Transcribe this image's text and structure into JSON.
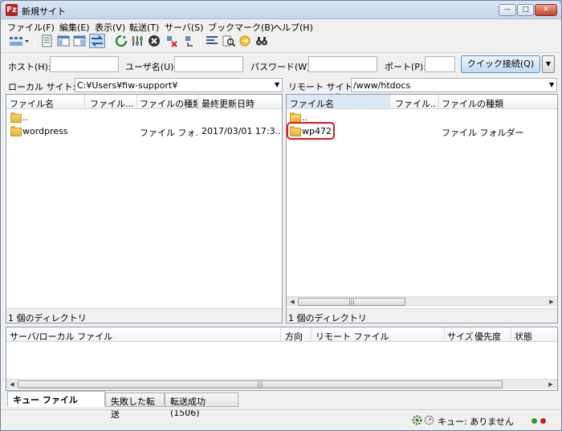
{
  "window": {
    "title": "新規サイト",
    "app_icon": "Fz"
  },
  "window_controls": {
    "minimize": "—",
    "maximize": "□",
    "close": "✕"
  },
  "menu": [
    {
      "label": "ファイル(F)"
    },
    {
      "label": "編集(E)"
    },
    {
      "label": "表示(V)"
    },
    {
      "label": "転送(T)"
    },
    {
      "label": "サーバ(S)"
    },
    {
      "label": "ブックマーク(B)"
    },
    {
      "label": "ヘルプ(H)"
    }
  ],
  "toolbar_icons": [
    "site-manager-icon",
    "message-log-icon",
    "local-tree-icon",
    "remote-tree-icon",
    "transfer-queue-icon",
    "refresh-icon",
    "filter-icon",
    "cancel-icon",
    "disconnect-icon",
    "reconnect-icon",
    "directory-compare-icon",
    "search-icon",
    "sync-browse-icon",
    "binoculars-icon"
  ],
  "quickconnect": {
    "host_label": "ホスト(H):",
    "user_label": "ユーザ名(U):",
    "password_label": "パスワード(W):",
    "port_label": "ポート(P):",
    "host_value": "",
    "user_value": "",
    "password_value": "",
    "port_value": "",
    "connect_button": "クイック接続(Q)",
    "dropdown_arrow": "▼"
  },
  "local": {
    "site_label": "ローカル サイト:",
    "path": "C:¥Users¥fiw-support¥",
    "columns": [
      "ファイル名",
      "ファイル...",
      "ファイルの種類",
      "最終更新日時"
    ],
    "rows": [
      {
        "name": "..",
        "size": "",
        "type": "",
        "modified": ""
      },
      {
        "name": "wordpress",
        "size": "",
        "type": "ファイル フォ...",
        "modified": "2017/03/01 17:3..."
      }
    ],
    "status": "1 個のディレクトリ"
  },
  "remote": {
    "site_label": "リモート サイト:",
    "path": "/www/htdocs",
    "columns": [
      "ファイル名",
      "ファイル...",
      "ファイルの種類"
    ],
    "sort_indicator": "^",
    "rows": [
      {
        "name": "..",
        "size": "",
        "type": ""
      },
      {
        "name": "wp472",
        "size": "",
        "type": "ファイル フォルダー"
      }
    ],
    "status": "1 個のディレクトリ"
  },
  "queue": {
    "columns": [
      "サーバ/ローカル ファイル",
      "方向",
      "リモート ファイル",
      "サイズ",
      "優先度",
      "状態"
    ],
    "scroll_grip": "|||",
    "tabs": [
      {
        "label": "キュー ファイル",
        "active": true
      },
      {
        "label": "失敗した転送",
        "active": false
      },
      {
        "label": "転送成功 (1506)",
        "active": false
      }
    ]
  },
  "statusbar": {
    "queue_text": "キュー: ありません",
    "led_colors": [
      "#2aa02a",
      "#c82020"
    ]
  },
  "colors": {
    "accent": "#5a8fc4",
    "highlight": "#e0111b",
    "folder": "#f0c24b"
  }
}
